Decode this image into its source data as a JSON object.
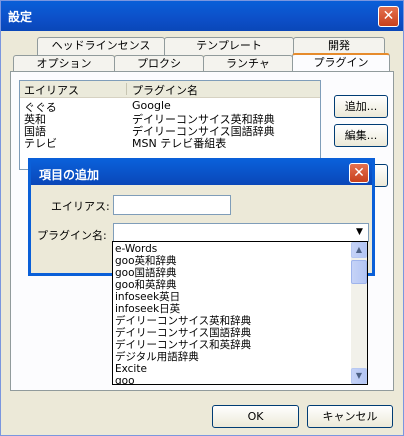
{
  "window": {
    "title": "設定",
    "close_glyph": "✕"
  },
  "tabs_row1": [
    "ヘッドラインセンス",
    "テンプレート",
    "開発"
  ],
  "tabs_row2": [
    "オプション",
    "プロクシ",
    "ランチャ",
    "プラグイン"
  ],
  "plugin_list": {
    "columns": [
      "エイリアス",
      "プラグイン名"
    ],
    "rows": [
      {
        "alias": "ぐぐる",
        "plugin": "Google"
      },
      {
        "alias": "英和",
        "plugin": "デイリーコンサイス英和辞典"
      },
      {
        "alias": "国語",
        "plugin": "デイリーコンサイス国語辞典"
      },
      {
        "alias": "テレビ",
        "plugin": "MSN テレビ番組表"
      }
    ]
  },
  "side_buttons": {
    "add": "追加...",
    "edit": "編集..."
  },
  "dialog": {
    "title": "項目の追加",
    "alias_label": "エイリアス:",
    "alias_value": "",
    "plugin_label": "プラグイン名:",
    "plugin_value": "",
    "combo_arrow": "▼"
  },
  "dropdown_items": [
    "e-Words",
    "goo英和辞典",
    "goo国語辞典",
    "goo和英辞典",
    "infoseek英日",
    "infoseek日英",
    "デイリーコンサイス英和辞典",
    "デイリーコンサイス国語辞典",
    "デイリーコンサイス和英辞典",
    "デジタル用語辞典",
    "Excite",
    "goo"
  ],
  "footer": {
    "ok": "OK",
    "cancel": "キャンセル"
  },
  "scroll": {
    "up": "▲",
    "down": "▼"
  }
}
